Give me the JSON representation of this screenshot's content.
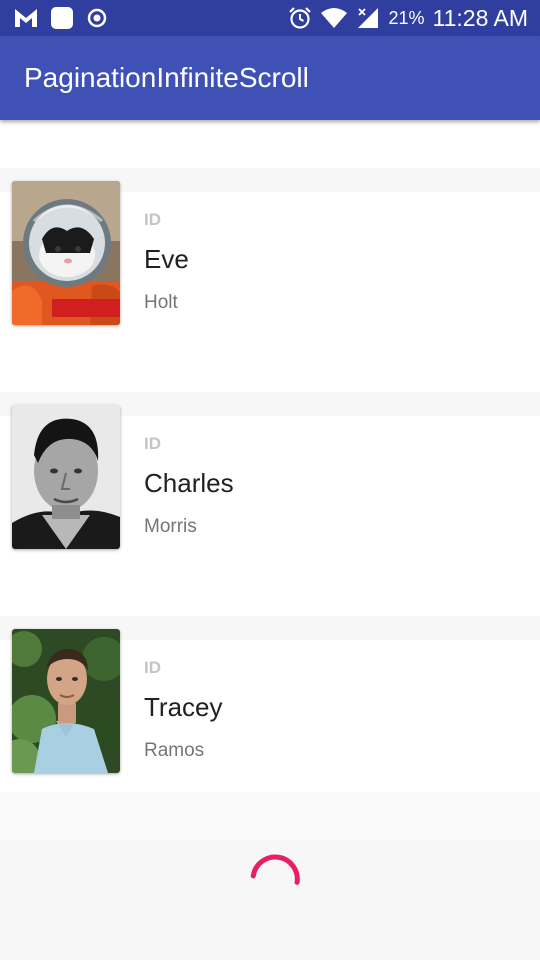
{
  "status_bar": {
    "left_icons": [
      "mail-m-icon",
      "square-app-icon",
      "record-icon"
    ],
    "right_icons": [
      "alarm-icon",
      "wifi-icon",
      "signal-icon"
    ],
    "battery_percent": "21%",
    "time": "11:28 AM"
  },
  "app_bar": {
    "title": "PaginationInfiniteScroll",
    "color": "#3f51b5",
    "status_color": "#303f9f"
  },
  "items": [
    {
      "id_label": "ID",
      "first_name": "Eve",
      "last_name": "Holt",
      "avatar": "astronaut-cat-photo"
    },
    {
      "id_label": "ID",
      "first_name": "Charles",
      "last_name": "Morris",
      "avatar": "man-portrait-bw-photo"
    },
    {
      "id_label": "ID",
      "first_name": "Tracey",
      "last_name": "Ramos",
      "avatar": "young-man-outdoor-photo"
    }
  ],
  "loader": {
    "accent": "#e91e63",
    "icon": "progress-spinner-icon"
  }
}
